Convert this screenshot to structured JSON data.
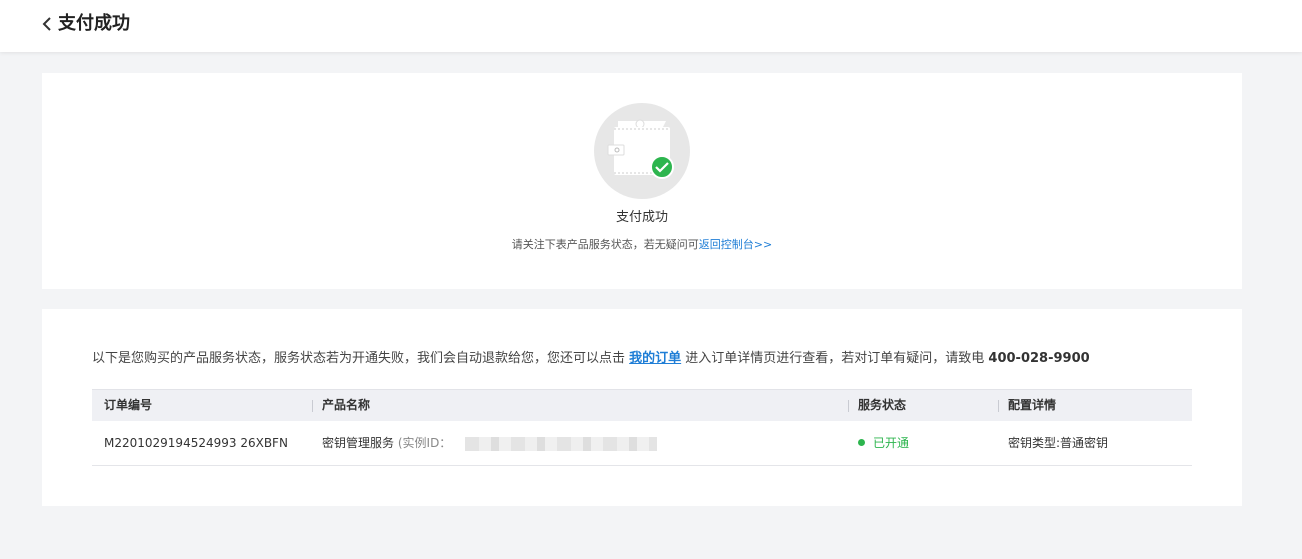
{
  "header": {
    "title": "支付成功",
    "back_icon": "chevron-left-icon"
  },
  "result": {
    "icon": "wallet-check-icon",
    "title": "支付成功",
    "note_prefix": "请关注下表产品服务状态，若无疑问可",
    "note_link": "返回控制台>>"
  },
  "details": {
    "intro_prefix": "以下是您购买的产品服务状态，服务状态若为开通失败，我们会自动退款给您，您还可以点击 ",
    "orders_link": "我的订单",
    "intro_middle": " 进入订单详情页进行查看，若对订单有疑问，请致电 ",
    "phone": "400-028-9900",
    "table": {
      "headers": [
        "订单编号",
        "产品名称",
        "服务状态",
        "配置详情"
      ],
      "rows": [
        {
          "order_no": "M2201029194524993 26XBFN",
          "product_name": "密钥管理服务",
          "instance_label": "(实例ID：",
          "status": "已开通",
          "config": "密钥类型:普通密钥"
        }
      ]
    }
  },
  "colors": {
    "link": "#1f7ed6",
    "success": "#2db54e",
    "page_bg": "#f3f4f6"
  }
}
